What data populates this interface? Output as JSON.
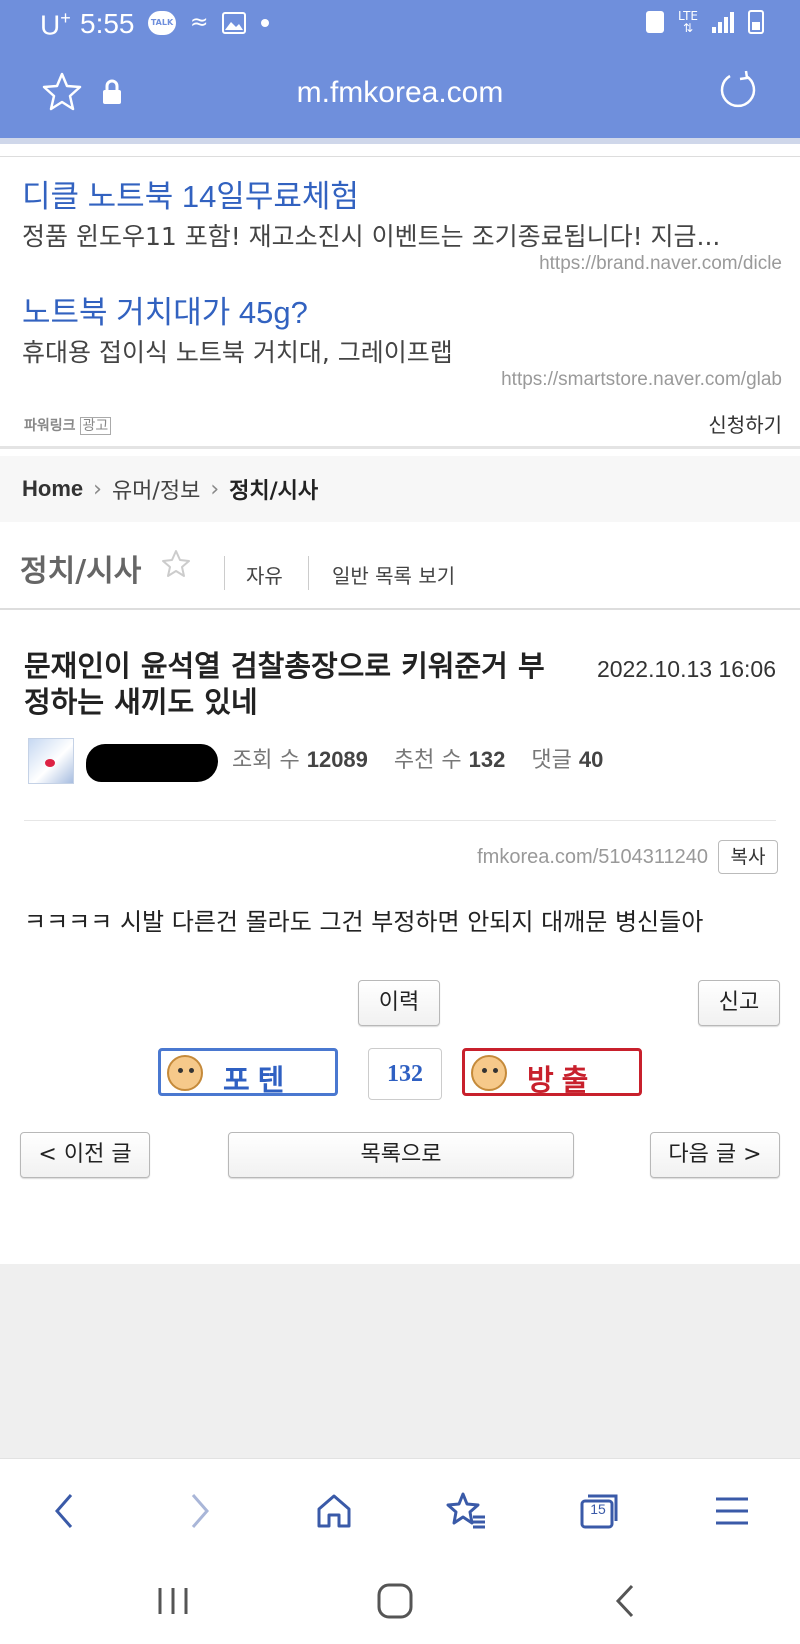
{
  "status_bar": {
    "carrier": "U",
    "carrier_plus": "+",
    "time": "5:55",
    "talk_badge": "TALK",
    "network": "LTE"
  },
  "browser": {
    "url": "m.fmkorea.com",
    "tab_count": "15"
  },
  "ads": {
    "items": [
      {
        "title": "디클 노트북 14일무료체험",
        "desc": "정품 윈도우11 포함! 재고소진시 이벤트는 조기종료됩니다! 지금...",
        "url": "https://brand.naver.com/dicle"
      },
      {
        "title": "노트북 거치대가 45g?",
        "desc": "휴대용 접이식 노트북 거치대, 그레이프랩",
        "url": "https://smartstore.naver.com/glab"
      }
    ],
    "powerlink": "파워링크",
    "ad_tag": "광고",
    "apply": "신청하기"
  },
  "breadcrumb": {
    "home": "Home",
    "level1": "유머/정보",
    "current": "정치/시사"
  },
  "board": {
    "title": "정치/시사",
    "tab_free": "자유",
    "tab_list": "일반 목록 보기"
  },
  "post": {
    "title": "문재인이 윤석열 검찰총장으로 키워준거 부정하는 새끼도 있네",
    "date": "2022.10.13 16:06",
    "views_label": "조회 수",
    "views": "12089",
    "likes_label": "추천 수",
    "likes": "132",
    "comments_label": "댓글",
    "comments": "40",
    "short_url": "fmkorea.com/5104311240",
    "copy_label": "복사",
    "body": "ㅋㅋㅋㅋ 시발 다른건 몰라도 그건 부정하면 안되지 대깨문 병신들아"
  },
  "actions": {
    "history": "이력",
    "report": "신고",
    "vote_up": "포텐",
    "vote_count": "132",
    "vote_down": "방출",
    "prev": "< 이전 글",
    "list": "목록으로",
    "next": "다음 글 >"
  },
  "colors": {
    "topbar": "#6f8fdc",
    "link": "#3262c0",
    "vote_up": "#4a78d0",
    "vote_down": "#c8202c"
  },
  "icons": [
    "star-icon",
    "lock-icon",
    "reload-icon",
    "back-icon",
    "forward-icon",
    "home-icon",
    "bookmarks-icon",
    "tabs-icon",
    "menu-icon"
  ]
}
